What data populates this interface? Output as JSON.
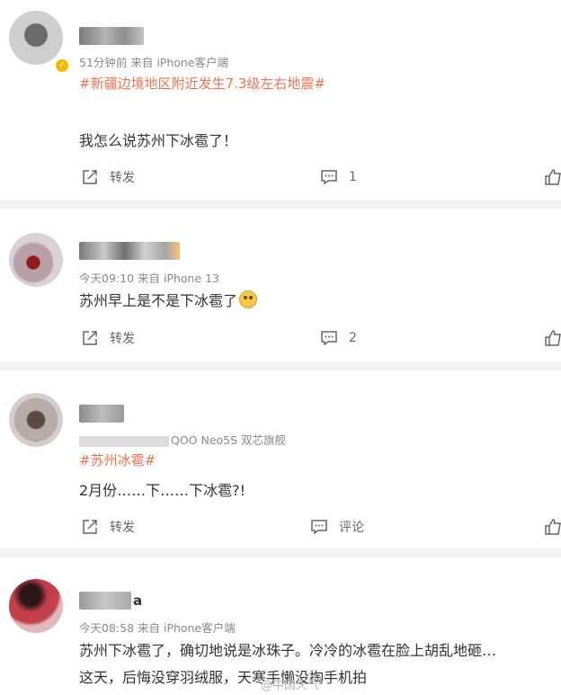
{
  "posts": [
    {
      "meta": "51分钟前  来自 iPhone客户端",
      "topic": "#新疆边境地区附近发生7.3级左右地震#",
      "text": "我怎么说苏州下冰雹了！",
      "repost_label": "转发",
      "comment_count": "1"
    },
    {
      "meta": "今天09:10  来自 iPhone 13",
      "text": "苏州早上是不是下冰雹了",
      "repost_label": "转发",
      "comment_count": "2"
    },
    {
      "meta": "QOO Neo5S 双芯旗舰",
      "topic": "#苏州冰雹#",
      "text": "2月份……下……下冰雹?!",
      "repost_label": "转发",
      "comment_label": "评论"
    },
    {
      "name_suffix": "a",
      "meta": "今天08:58  来自 iPhone客户端",
      "text_line1": "苏州下冰雹了，确切地说是冰珠子。冷冷的冰雹在脸上胡乱地砸…",
      "text_line2": "这天，后悔没穿羽绒服，天寒手懒没掏手机拍"
    }
  ],
  "watermark": "@中国天气",
  "colors": {
    "topic": "#eb7350",
    "meta": "#8a8a8a",
    "separator": "#f2f2f2"
  },
  "icons": [
    "repost-icon",
    "comment-icon",
    "like-icon",
    "verified-badge-icon",
    "emoji-icon"
  ]
}
